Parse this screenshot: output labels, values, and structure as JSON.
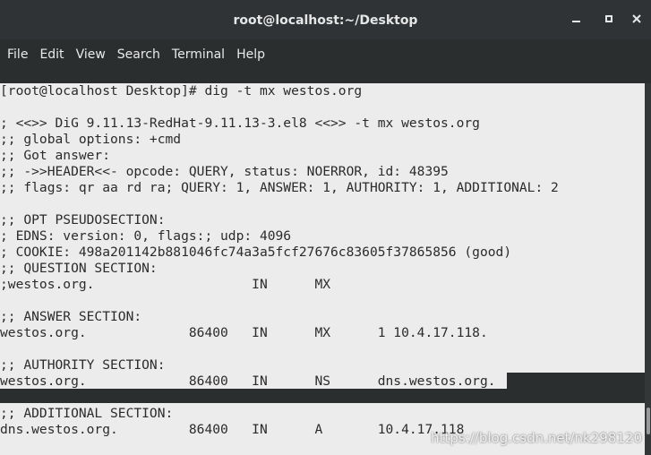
{
  "window": {
    "title": "root@localhost:~/Desktop",
    "minimize_glyph": "▁",
    "maximize_glyph": "□",
    "close_glyph": "✕"
  },
  "menu": [
    "File",
    "Edit",
    "View",
    "Search",
    "Terminal",
    "Help"
  ],
  "terminal": {
    "lines": [
      "[root@localhost Desktop]# dig -t mx westos.org",
      "",
      "; <<>> DiG 9.11.13-RedHat-9.11.13-3.el8 <<>> -t mx westos.org",
      ";; global options: +cmd",
      ";; Got answer:",
      ";; ->>HEADER<<- opcode: QUERY, status: NOERROR, id: 48395",
      ";; flags: qr aa rd ra; QUERY: 1, ANSWER: 1, AUTHORITY: 1, ADDITIONAL: 2",
      "",
      ";; OPT PSEUDOSECTION:",
      "; EDNS: version: 0, flags:; udp: 4096",
      "; COOKIE: 498a201142b881046fc74a3a5fcf27676c83605f37865856 (good)",
      ";; QUESTION SECTION:",
      ";westos.org.                    IN      MX",
      "",
      ";; ANSWER SECTION:",
      "westos.org.             86400   IN      MX      1 10.4.17.118.",
      "",
      ";; AUTHORITY SECTION:",
      "westos.org.             86400   IN      NS      dns.westos.org.",
      "",
      ";; ADDITIONAL SECTION:",
      "dns.westos.org.         86400   IN      A       10.4.17.118"
    ]
  },
  "watermark": "https://blog.csdn.net/nk298120"
}
